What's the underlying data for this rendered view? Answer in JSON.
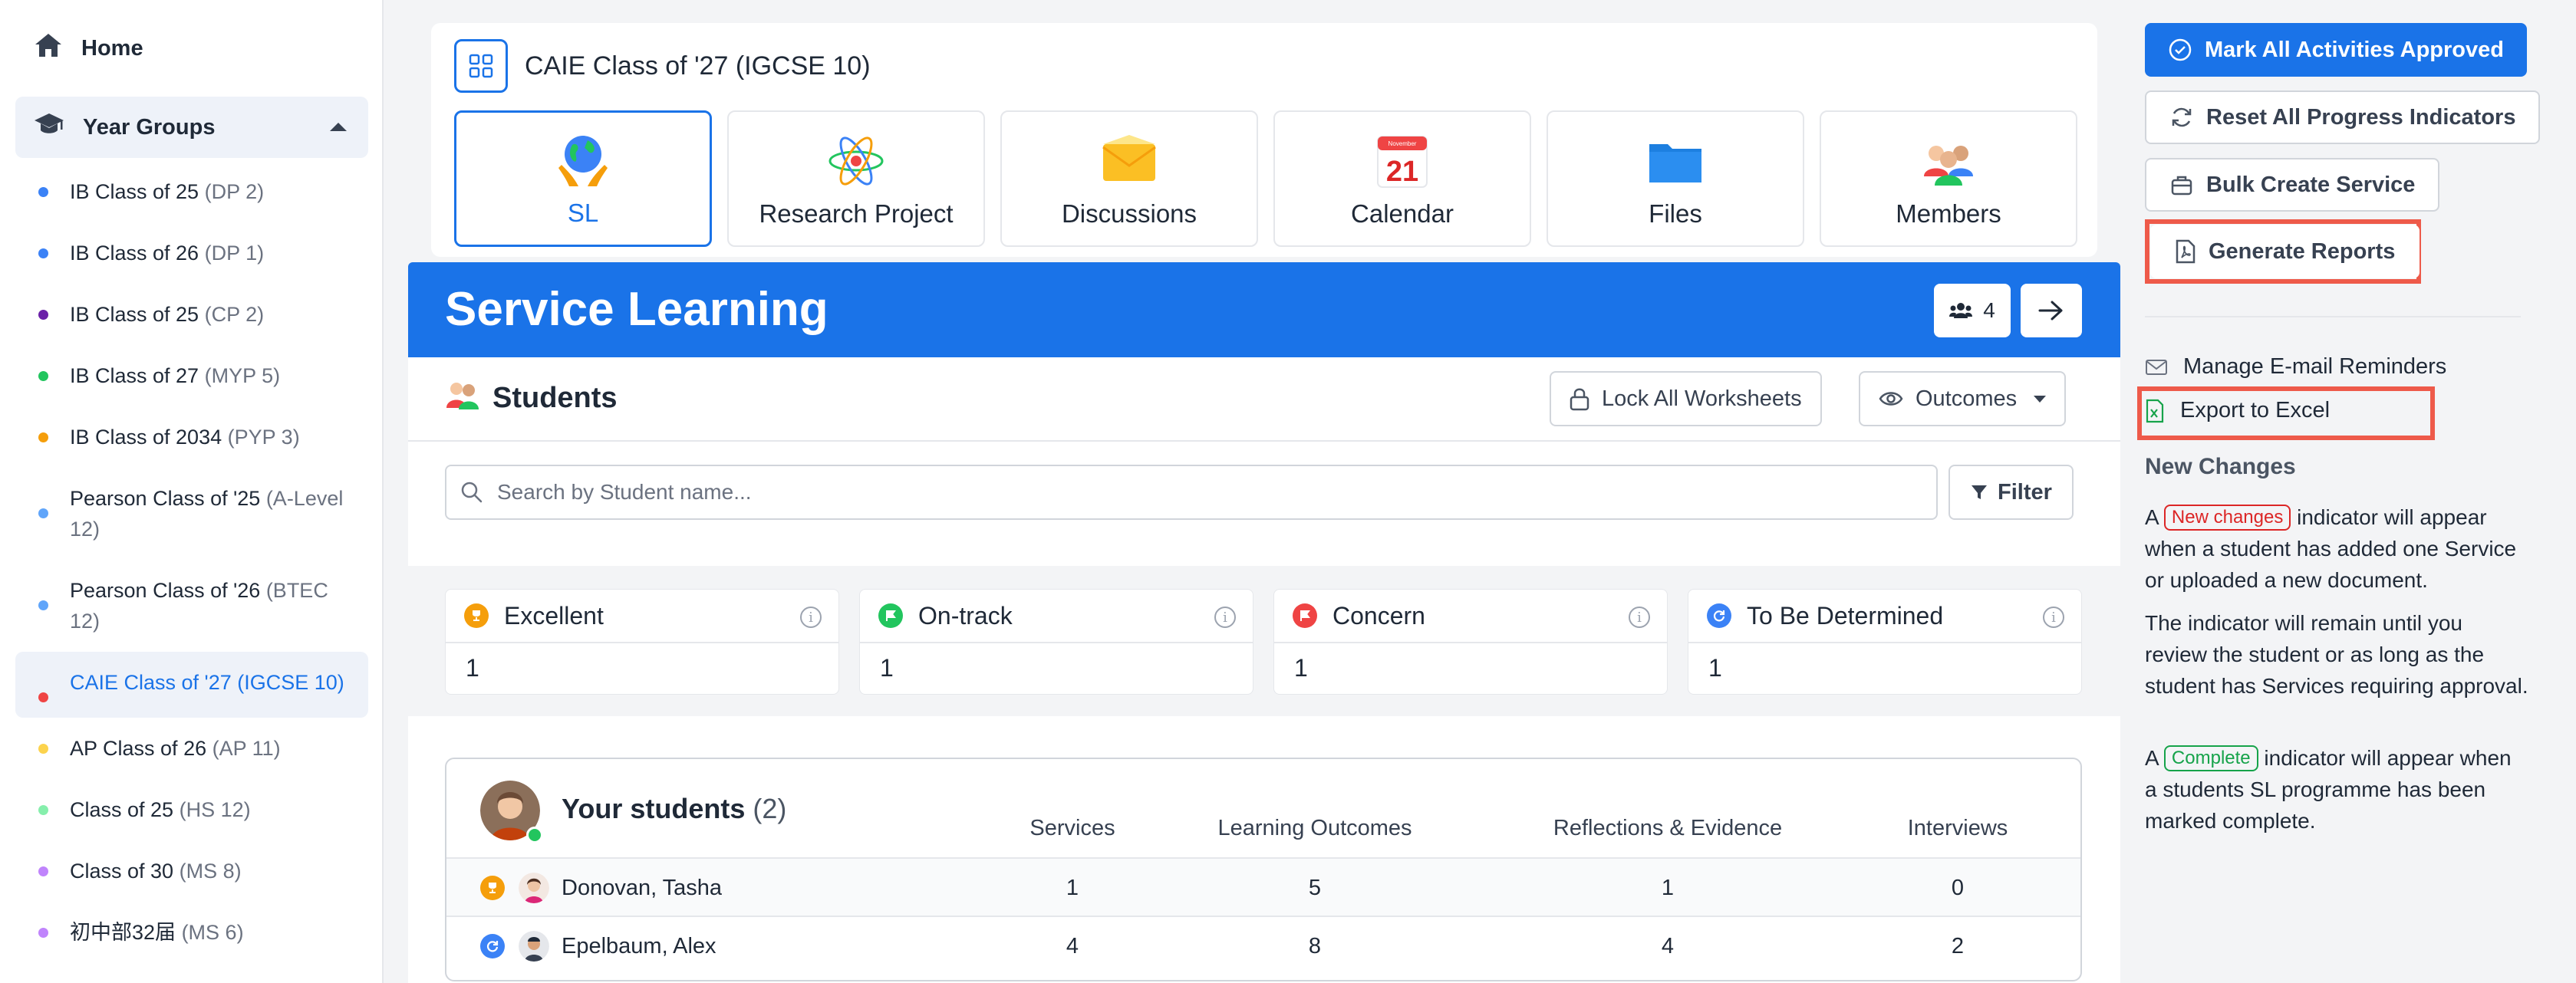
{
  "sidebar": {
    "home_label": "Home",
    "group_label": "Year Groups",
    "items": [
      {
        "label": "IB Class of 25",
        "sub": "(DP 2)",
        "color": "#3b82f6"
      },
      {
        "label": "IB Class of 26",
        "sub": "(DP 1)",
        "color": "#3b82f6"
      },
      {
        "label": "IB Class of 25",
        "sub": "(CP 2)",
        "color": "#6b21a8"
      },
      {
        "label": "IB Class of 27",
        "sub": "(MYP 5)",
        "color": "#22c55e"
      },
      {
        "label": "IB Class of 2034",
        "sub": "(PYP 3)",
        "color": "#f59e0b"
      },
      {
        "label": "Pearson Class of '25",
        "sub": "(A-Level 12)",
        "color": "#60a5fa"
      },
      {
        "label": "Pearson Class of '26",
        "sub": "(BTEC 12)",
        "color": "#60a5fa"
      },
      {
        "label": "CAIE Class of '27",
        "sub": "(IGCSE 10)",
        "color": "#ef4444"
      },
      {
        "label": "AP Class of 26",
        "sub": "(AP 11)",
        "color": "#fcd34d"
      },
      {
        "label": "Class of 25",
        "sub": "(HS 12)",
        "color": "#86efac"
      },
      {
        "label": "Class of 30",
        "sub": "(MS 8)",
        "color": "#c084fc"
      },
      {
        "label": "初中部32届",
        "sub": "(MS 6)",
        "color": "#c084fc"
      }
    ]
  },
  "header": {
    "class_title": "CAIE Class of '27 (IGCSE 10)",
    "tiles": [
      {
        "label": "SL",
        "icon": "globe-hands-icon"
      },
      {
        "label": "Research Project",
        "icon": "atom-icon"
      },
      {
        "label": "Discussions",
        "icon": "envelope-icon"
      },
      {
        "label": "Calendar",
        "icon": "calendar-icon",
        "calendar_month": "November",
        "calendar_day": "21"
      },
      {
        "label": "Files",
        "icon": "folder-icon"
      },
      {
        "label": "Members",
        "icon": "people-icon"
      }
    ]
  },
  "banner": {
    "title": "Service Learning",
    "member_count": "4"
  },
  "students": {
    "heading": "Students",
    "lock_label": "Lock All Worksheets",
    "outcomes_label": "Outcomes",
    "search_placeholder": "Search by Student name...",
    "filter_label": "Filter"
  },
  "status_cards": [
    {
      "label": "Excellent",
      "value": "1",
      "color": "#f59e0b"
    },
    {
      "label": "On-track",
      "value": "1",
      "color": "#22c55e"
    },
    {
      "label": "Concern",
      "value": "1",
      "color": "#ef4444"
    },
    {
      "label": "To Be Determined",
      "value": "1",
      "color": "#3b82f6"
    }
  ],
  "table": {
    "title": "Your students",
    "count": "(2)",
    "columns": [
      "Services",
      "Learning Outcomes",
      "Reflections & Evidence",
      "Interviews"
    ],
    "rows": [
      {
        "name": "Donovan, Tasha",
        "status": "excellent",
        "values": [
          "1",
          "5",
          "1",
          "0"
        ]
      },
      {
        "name": "Epelbaum, Alex",
        "status": "tbd",
        "values": [
          "4",
          "8",
          "4",
          "2"
        ]
      }
    ]
  },
  "right_panel": {
    "mark_approved": "Mark All Activities Approved",
    "reset_progress": "Reset All Progress Indicators",
    "bulk_create": "Bulk Create Service",
    "generate_reports": "Generate Reports",
    "manage_reminders": "Manage E-mail Reminders",
    "export_excel": "Export to Excel",
    "new_changes_heading": "New Changes",
    "para1_a": "A",
    "badge_new": "New changes",
    "para1_b": "indicator will appear when a student has added one Service or uploaded a new document.",
    "para2": "The indicator will remain until you review the student or as long as the student has Services requiring approval.",
    "para3_a": "A",
    "badge_complete": "Complete",
    "para3_b": "indicator will appear when a students SL programme has been marked complete."
  },
  "colors": {
    "accent": "#1a73e8",
    "highlight": "#ee5a4a"
  }
}
